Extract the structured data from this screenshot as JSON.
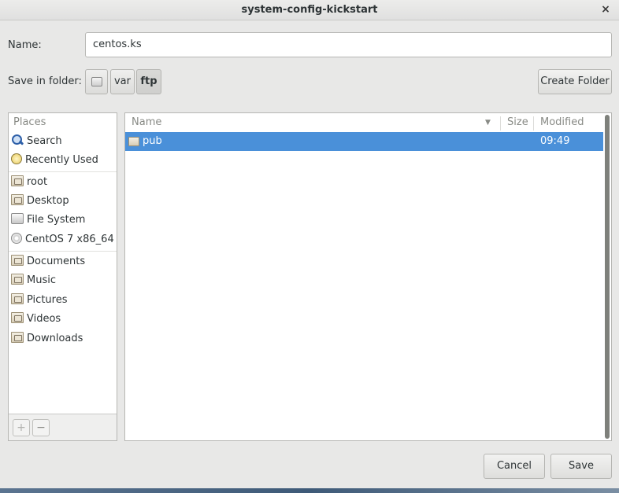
{
  "window": {
    "title": "system-config-kickstart",
    "close_glyph": "×"
  },
  "name_field": {
    "label": "Name:",
    "value": "centos.ks"
  },
  "save_in": {
    "label": "Save in folder:",
    "path": [
      {
        "kind": "drive-icon",
        "label": ""
      },
      {
        "label": "var"
      },
      {
        "label": "ftp",
        "active": true
      }
    ],
    "create_folder_label": "Create Folder"
  },
  "places": {
    "header": "Places",
    "items": [
      {
        "label": "Search",
        "icon": "search-icon"
      },
      {
        "label": "Recently Used",
        "icon": "recent-icon"
      },
      {
        "label": "root",
        "icon": "home-folder-icon"
      },
      {
        "label": "Desktop",
        "icon": "desktop-folder-icon"
      },
      {
        "label": "File System",
        "icon": "filesystem-icon"
      },
      {
        "label": "CentOS 7 x86_64",
        "icon": "disc-icon"
      },
      {
        "label": "Documents",
        "icon": "documents-folder-icon"
      },
      {
        "label": "Music",
        "icon": "music-folder-icon"
      },
      {
        "label": "Pictures",
        "icon": "pictures-folder-icon"
      },
      {
        "label": "Videos",
        "icon": "videos-folder-icon"
      },
      {
        "label": "Downloads",
        "icon": "downloads-folder-icon"
      }
    ],
    "add_glyph": "+",
    "remove_glyph": "−"
  },
  "files": {
    "columns": {
      "name": "Name",
      "size": "Size",
      "modified": "Modified"
    },
    "sort_glyph": "▼",
    "rows": [
      {
        "name": "pub",
        "size": "",
        "modified": "09:49",
        "icon": "folder-icon",
        "selected": true
      }
    ]
  },
  "actions": {
    "cancel_label": "Cancel",
    "save_label": "Save"
  },
  "colors": {
    "selection": "#4a90d9",
    "background": "#e8e8e7"
  }
}
